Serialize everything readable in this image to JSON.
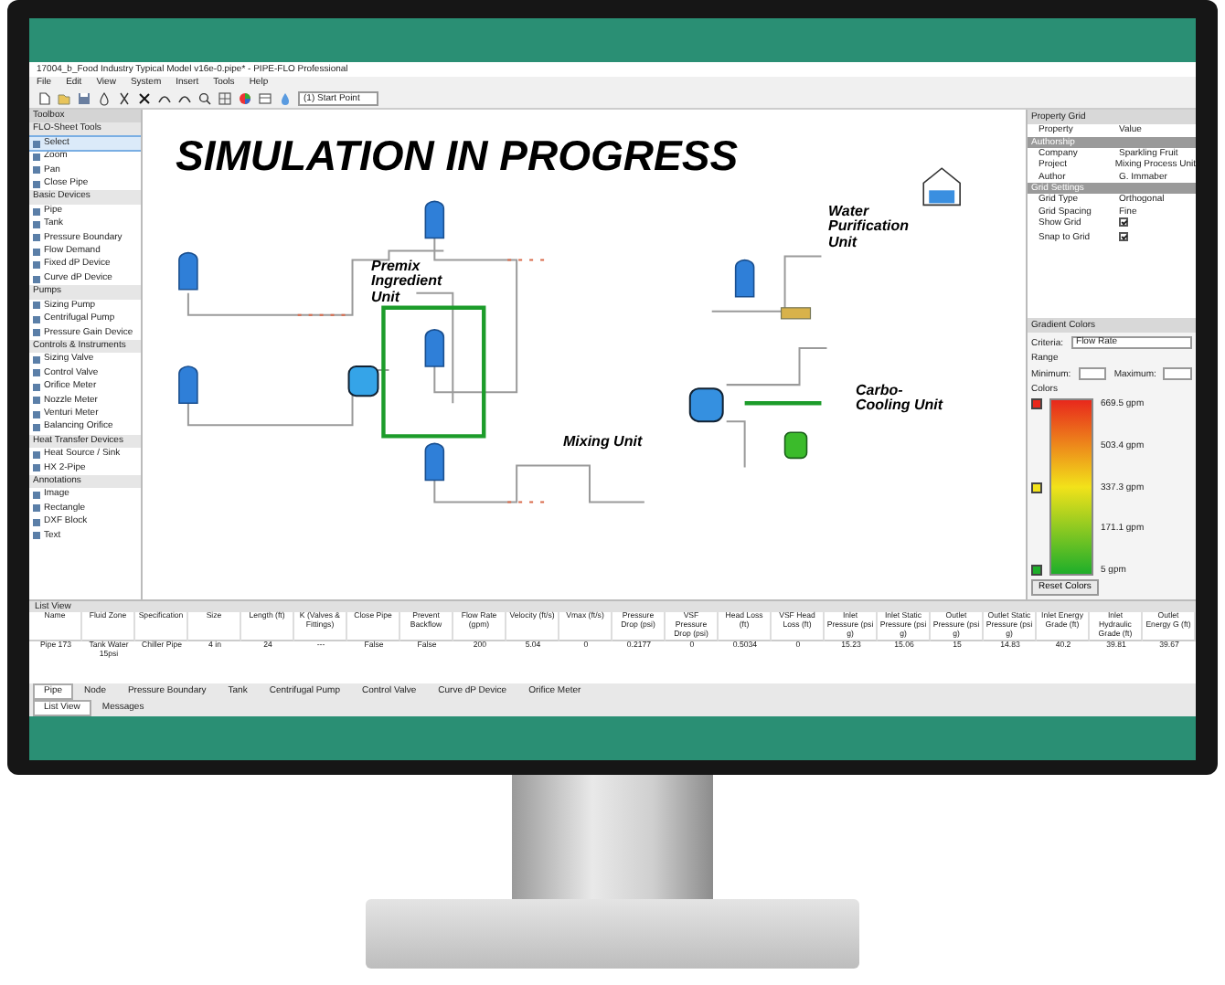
{
  "window": {
    "title": "17004_b_Food Industry Typical Model v16e-0.pipe* - PIPE-FLO Professional"
  },
  "menu": [
    "File",
    "Edit",
    "View",
    "System",
    "Insert",
    "Tools",
    "Help"
  ],
  "toolbar": {
    "start_point": "(1) Start Point"
  },
  "toolbox": {
    "title": "Toolbox",
    "groups": [
      {
        "name": "FLO-Sheet Tools",
        "items": [
          {
            "label": "Select",
            "selected": true
          },
          {
            "label": "Zoom",
            "selected": false
          },
          {
            "label": "Pan",
            "selected": false
          },
          {
            "label": "Close Pipe",
            "selected": false
          }
        ]
      },
      {
        "name": "Basic Devices",
        "items": [
          {
            "label": "Pipe",
            "selected": false
          },
          {
            "label": "Tank",
            "selected": false
          },
          {
            "label": "Pressure Boundary",
            "selected": false
          },
          {
            "label": "Flow Demand",
            "selected": false
          },
          {
            "label": "Fixed dP Device",
            "selected": false
          },
          {
            "label": "Curve dP Device",
            "selected": false
          }
        ]
      },
      {
        "name": "Pumps",
        "items": [
          {
            "label": "Sizing Pump",
            "selected": false
          },
          {
            "label": "Centrifugal Pump",
            "selected": false
          },
          {
            "label": "Pressure Gain Device",
            "selected": false
          }
        ]
      },
      {
        "name": "Controls & Instruments",
        "items": [
          {
            "label": "Sizing Valve",
            "selected": false
          },
          {
            "label": "Control Valve",
            "selected": false
          },
          {
            "label": "Orifice Meter",
            "selected": false
          },
          {
            "label": "Nozzle Meter",
            "selected": false
          },
          {
            "label": "Venturi Meter",
            "selected": false
          },
          {
            "label": "Balancing Orifice",
            "selected": false
          }
        ]
      },
      {
        "name": "Heat Transfer Devices",
        "items": [
          {
            "label": "Heat Source / Sink",
            "selected": false
          },
          {
            "label": "HX 2-Pipe",
            "selected": false
          }
        ]
      },
      {
        "name": "Annotations",
        "items": [
          {
            "label": "Image",
            "selected": false
          },
          {
            "label": "Rectangle",
            "selected": false
          },
          {
            "label": "DXF Block",
            "selected": false
          },
          {
            "label": "Text",
            "selected": false
          }
        ]
      }
    ]
  },
  "canvas": {
    "heading": "SIMULATION IN PROGRESS",
    "units": [
      "Premix Ingredient Unit",
      "Water Purification Unit",
      "Mixing Unit",
      "Carbo-Cooling Unit"
    ]
  },
  "property_grid": {
    "title": "Property Grid",
    "columns": [
      "Property",
      "Value"
    ],
    "sections": [
      {
        "name": "Authorship",
        "rows": [
          {
            "kind": "text",
            "property": "Company",
            "value": "Sparkling Fruit"
          },
          {
            "kind": "text",
            "property": "Project",
            "value": "Mixing Process Unit"
          },
          {
            "kind": "text",
            "property": "Author",
            "value": "G. Immaber"
          }
        ]
      },
      {
        "name": "Grid Settings",
        "rows": [
          {
            "kind": "text",
            "property": "Grid Type",
            "value": "Orthogonal"
          },
          {
            "kind": "text",
            "property": "Grid Spacing",
            "value": "Fine"
          },
          {
            "kind": "check",
            "property": "Show Grid",
            "checked": true
          },
          {
            "kind": "check",
            "property": "Snap to Grid",
            "checked": true
          }
        ]
      }
    ]
  },
  "gradient_colors": {
    "title": "Gradient Colors",
    "criteria_label": "Criteria:",
    "criteria": "Flow Rate",
    "range_label": "Range",
    "minimum_label": "Minimum:",
    "maximum_label": "Maximum:",
    "colors_label": "Colors",
    "stops": [
      {
        "color": "#e8281c"
      },
      {
        "color": "#f2e21a"
      },
      {
        "color": "#1eae2a"
      }
    ],
    "scale": [
      "669.5 gpm",
      "503.4 gpm",
      "337.3 gpm",
      "171.1 gpm",
      "5 gpm"
    ],
    "reset": "Reset Colors"
  },
  "list_view": {
    "title": "List View",
    "columns": [
      "Name",
      "Fluid Zone",
      "Specification",
      "Size",
      "Length (ft)",
      "K (Valves & Fittings)",
      "Close Pipe",
      "Prevent Backflow",
      "Flow Rate (gpm)",
      "Velocity (ft/s)",
      "Vmax (ft/s)",
      "Pressure Drop (psi)",
      "VSF Pressure Drop (psi)",
      "Head Loss (ft)",
      "VSF Head Loss (ft)",
      "Inlet Pressure (psi g)",
      "Inlet Static Pressure (psi g)",
      "Outlet Pressure (psi g)",
      "Outlet Static Pressure (psi g)",
      "Inlet Energy Grade (ft)",
      "Inlet Hydraulic Grade (ft)",
      "Outlet Energy G (ft)"
    ],
    "rows": [
      [
        "Pipe 173",
        "Tank Water 15psi",
        "Chiller Pipe",
        "4 in",
        "24",
        "---",
        "False",
        "False",
        "200",
        "5.04",
        "0",
        "0.2177",
        "0",
        "0.5034",
        "0",
        "15.23",
        "15.06",
        "15",
        "14.83",
        "40.2",
        "39.81",
        "39.67"
      ]
    ]
  },
  "tabs": [
    {
      "label": "Pipe",
      "selected": true
    },
    {
      "label": "Node",
      "selected": false
    },
    {
      "label": "Pressure Boundary",
      "selected": false
    },
    {
      "label": "Tank",
      "selected": false
    },
    {
      "label": "Centrifugal Pump",
      "selected": false
    },
    {
      "label": "Control Valve",
      "selected": false
    },
    {
      "label": "Curve dP Device",
      "selected": false
    },
    {
      "label": "Orifice Meter",
      "selected": false
    }
  ],
  "bottom_tabs": [
    {
      "label": "List View",
      "selected": true
    },
    {
      "label": "Messages",
      "selected": false
    }
  ]
}
